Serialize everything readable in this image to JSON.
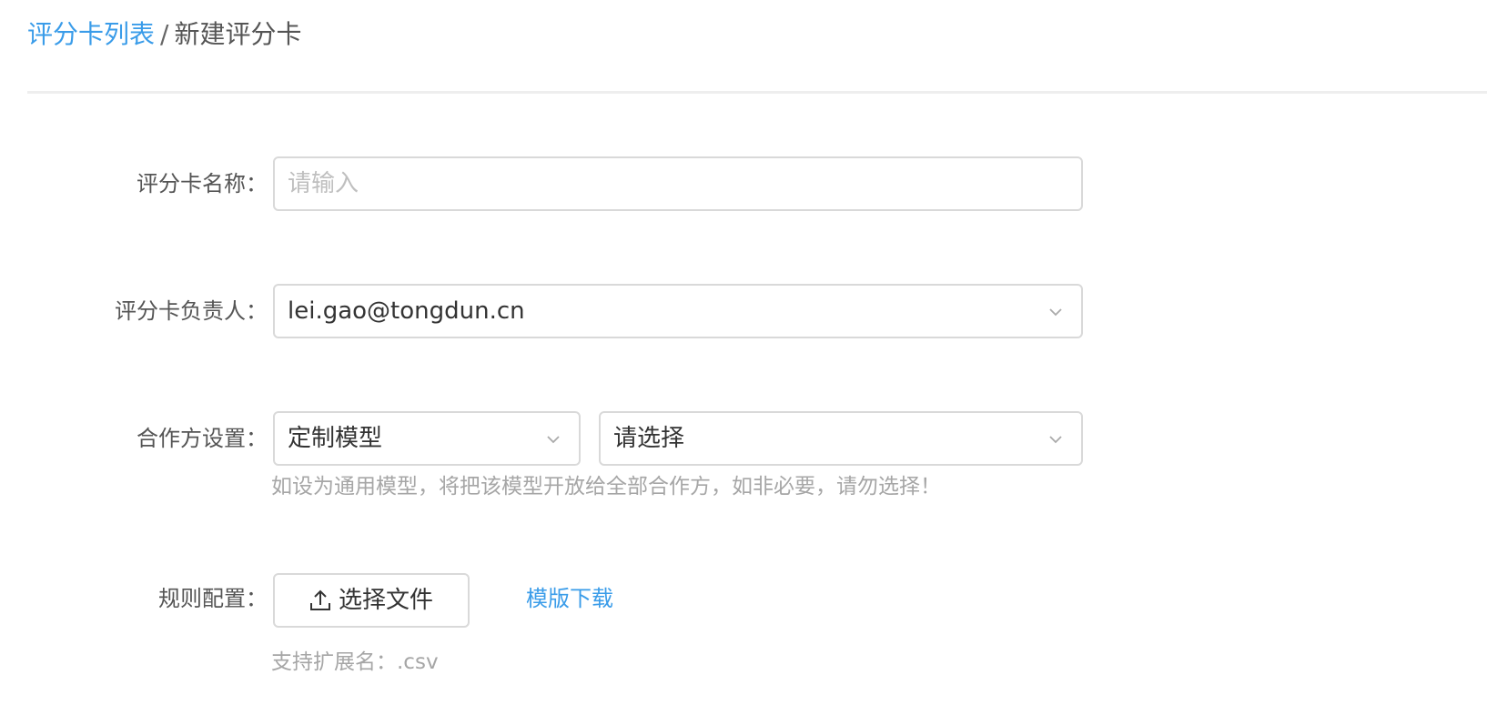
{
  "breadcrumb": {
    "parent": "评分卡列表",
    "separator": "/",
    "current": "新建评分卡"
  },
  "form": {
    "name": {
      "label": "评分卡名称：",
      "placeholder": "请输入"
    },
    "owner": {
      "label": "评分卡负责人：",
      "value": "lei.gao@tongdun.cn",
      "icon": "chevron-down-icon"
    },
    "partner": {
      "label": "合作方设置：",
      "model_type": "定制模型",
      "partner_select": "请选择",
      "hint": "如设为通用模型，将把该模型开放给全部合作方，如非必要，请勿选择！",
      "icon": "chevron-down-icon"
    },
    "rules": {
      "label": "规则配置：",
      "upload_button": "选择文件",
      "upload_icon": "upload-icon",
      "template_link": "模版下载",
      "hint": "支持扩展名：.csv"
    }
  },
  "colors": {
    "link": "#3a9ce9",
    "border": "#d9d9d9",
    "placeholder": "#bfbfbf",
    "hint": "#a6a6a6"
  }
}
